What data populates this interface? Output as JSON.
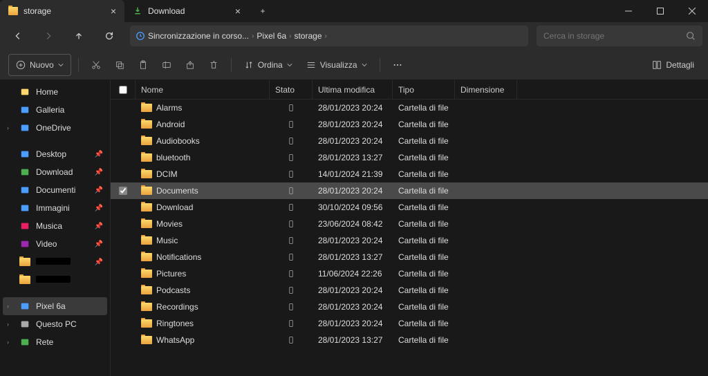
{
  "window": {
    "tabs": [
      {
        "label": "storage",
        "icon": "folder",
        "active": true
      },
      {
        "label": "Download",
        "icon": "download",
        "active": false
      }
    ]
  },
  "nav": {
    "breadcrumb": [
      {
        "label": "Sincronizzazione in corso..."
      },
      {
        "label": "Pixel 6a"
      },
      {
        "label": "storage"
      }
    ],
    "search_placeholder": "Cerca in storage"
  },
  "toolbar": {
    "new_label": "Nuovo",
    "sort_label": "Ordina",
    "view_label": "Visualizza",
    "details_label": "Dettagli"
  },
  "sidebar": {
    "quick": [
      {
        "label": "Home",
        "icon": "home"
      },
      {
        "label": "Galleria",
        "icon": "gallery"
      },
      {
        "label": "OneDrive",
        "icon": "onedrive",
        "expandable": true
      }
    ],
    "pinned": [
      {
        "label": "Desktop",
        "icon": "desktop",
        "pinned": true
      },
      {
        "label": "Download",
        "icon": "download",
        "pinned": true
      },
      {
        "label": "Documenti",
        "icon": "documents",
        "pinned": true
      },
      {
        "label": "Immagini",
        "icon": "pictures",
        "pinned": true
      },
      {
        "label": "Musica",
        "icon": "music",
        "pinned": true
      },
      {
        "label": "Video",
        "icon": "video",
        "pinned": true
      },
      {
        "label": "",
        "icon": "folder-redact",
        "pinned": true
      },
      {
        "label": "",
        "icon": "folder-redact",
        "pinned": false
      }
    ],
    "devices": [
      {
        "label": "Pixel 6a",
        "icon": "phone",
        "selected": true,
        "expandable": true
      },
      {
        "label": "Questo PC",
        "icon": "pc",
        "expandable": true
      },
      {
        "label": "Rete",
        "icon": "network",
        "expandable": true
      }
    ]
  },
  "columns": {
    "name": "Nome",
    "state": "Stato",
    "modified": "Ultima modifica",
    "type": "Tipo",
    "size": "Dimensione"
  },
  "files": [
    {
      "name": "Alarms",
      "modified": "28/01/2023 20:24",
      "type": "Cartella di file",
      "selected": false
    },
    {
      "name": "Android",
      "modified": "28/01/2023 20:24",
      "type": "Cartella di file",
      "selected": false
    },
    {
      "name": "Audiobooks",
      "modified": "28/01/2023 20:24",
      "type": "Cartella di file",
      "selected": false
    },
    {
      "name": "bluetooth",
      "modified": "28/01/2023 13:27",
      "type": "Cartella di file",
      "selected": false
    },
    {
      "name": "DCIM",
      "modified": "14/01/2024 21:39",
      "type": "Cartella di file",
      "selected": false
    },
    {
      "name": "Documents",
      "modified": "28/01/2023 20:24",
      "type": "Cartella di file",
      "selected": true
    },
    {
      "name": "Download",
      "modified": "30/10/2024 09:56",
      "type": "Cartella di file",
      "selected": false
    },
    {
      "name": "Movies",
      "modified": "23/06/2024 08:42",
      "type": "Cartella di file",
      "selected": false
    },
    {
      "name": "Music",
      "modified": "28/01/2023 20:24",
      "type": "Cartella di file",
      "selected": false
    },
    {
      "name": "Notifications",
      "modified": "28/01/2023 13:27",
      "type": "Cartella di file",
      "selected": false
    },
    {
      "name": "Pictures",
      "modified": "11/06/2024 22:26",
      "type": "Cartella di file",
      "selected": false
    },
    {
      "name": "Podcasts",
      "modified": "28/01/2023 20:24",
      "type": "Cartella di file",
      "selected": false
    },
    {
      "name": "Recordings",
      "modified": "28/01/2023 20:24",
      "type": "Cartella di file",
      "selected": false
    },
    {
      "name": "Ringtones",
      "modified": "28/01/2023 20:24",
      "type": "Cartella di file",
      "selected": false
    },
    {
      "name": "WhatsApp",
      "modified": "28/01/2023 13:27",
      "type": "Cartella di file",
      "selected": false
    }
  ]
}
